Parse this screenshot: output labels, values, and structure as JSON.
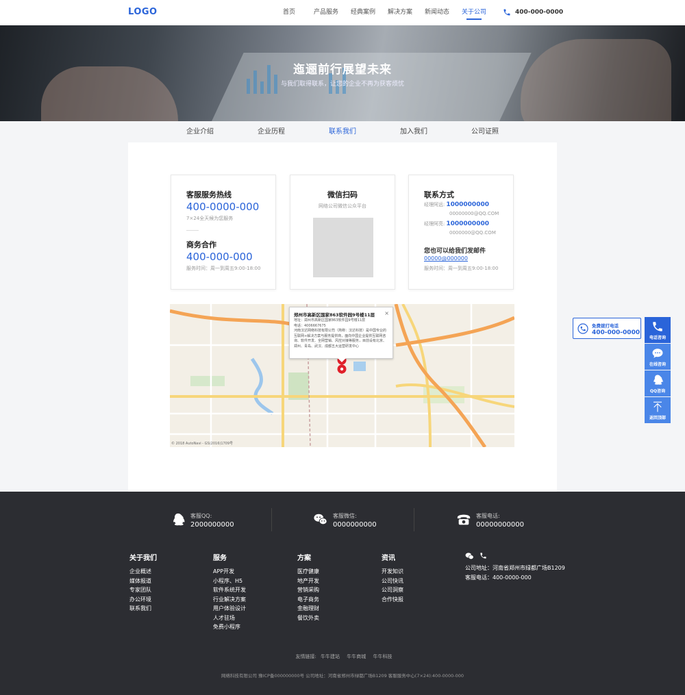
{
  "header": {
    "logo": "LOGO",
    "nav": [
      "首页",
      "产品服务",
      "经典案例",
      "解决方案",
      "新闻动态",
      "关于公司"
    ],
    "active_index": 5,
    "phone": "400-000-0000"
  },
  "banner": {
    "title": "迤逦前行展望未来",
    "subtitle": "与我们取得联系，让您的企业不再为获客烦忧"
  },
  "subnav": {
    "items": [
      "企业介绍",
      "企业历程",
      "联系我们",
      "加入我们",
      "公司证照"
    ],
    "active_index": 2
  },
  "cards": {
    "hotline": {
      "title": "客服服务热线",
      "number": "400-0000-000",
      "note": "7×24全天候为您服务",
      "title2": "商务合作",
      "number2": "400-000-000",
      "note2": "服务时间：周一到周五9:00-18:00"
    },
    "wechat": {
      "title": "微信扫码",
      "subtitle": "网络公司微信公众平台"
    },
    "contact": {
      "title": "联系方式",
      "m1_label": "经理阿远:",
      "m1_phone": "1000000000",
      "m1_mail": "00000000@QQ.COM",
      "m2_label": "经理阿亮:",
      "m2_phone": "1000000000",
      "m2_mail": "0000000@QQ.COM",
      "email_title": "您也可以给我们发邮件",
      "email": "00000@000000",
      "hours": "服务时间：周一到周五9:00-18:00"
    }
  },
  "map": {
    "popup_title": "郑州市高新区国家863软件园9号楼11层",
    "popup_close": "×",
    "addr": "地址：郑州市高新区国家863软件园9号楼11层",
    "tel": "电话：4006667675",
    "desc": "河南汉达网络科技有限公司（简称：汉达科技）是中国专业的互联网+解决方案与服务提供商，面向中国企业提供互联网咨询、软件开发、全网营销、风控对接等服务，目前设有北京、郑州、青岛、武汉、成都五大运营研发中心",
    "credit": "© 2018 AutoNavi - GS(2016)1709号"
  },
  "float": {
    "popout_title": "免费拨打电话",
    "popout_number": "400-000-0000",
    "buttons": [
      "电话咨询",
      "在线咨询",
      "QQ咨询",
      "返回顶部"
    ]
  },
  "footer": {
    "qq_label": "客服QQ:",
    "qq": "2000000000",
    "wechat_label": "客服微信:",
    "wechat": "0000000000",
    "tel_label": "客服电话:",
    "tel": "00000000000",
    "cols": [
      {
        "title": "关于我们",
        "items": [
          "企业概述",
          "媒体报道",
          "专家团队",
          "办公环境",
          "联系我们"
        ]
      },
      {
        "title": "服务",
        "items": [
          "APP开发",
          "小程序、H5",
          "软件系统开发",
          "行业解决方案",
          "用户体验设计",
          "人才驻场",
          "免费小程序"
        ]
      },
      {
        "title": "方案",
        "items": [
          "医疗健康",
          "地产开发",
          "营销采购",
          "电子商务",
          "金融理财",
          "餐饮外卖"
        ]
      },
      {
        "title": "资讯",
        "items": [
          "开发知识",
          "公司快讯",
          "公司洞察",
          "合作快报"
        ]
      }
    ],
    "address": "公司地址：河南省郑州市绿都广场B1209",
    "service_tel": "客服电话：400-0000-000",
    "links_label": "友情链接:",
    "links": [
      "牛牛建站",
      "牛牛商城",
      "牛牛科技"
    ],
    "copyright": "网络科技有限公司 豫ICP备000000000号 公司地址：河南省郑州市绿都广场B1209 客服服务中心(7×24):400-0000-000"
  },
  "colors": {
    "accent": "#2a64d9",
    "float": "#4a86e8",
    "footer_bg": "#2c2d32"
  }
}
